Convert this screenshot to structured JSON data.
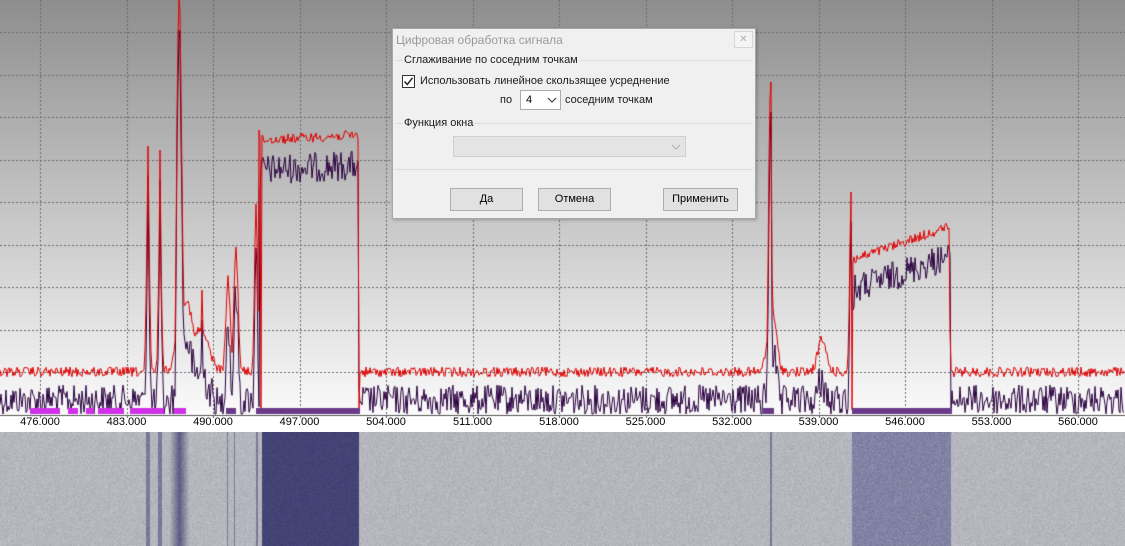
{
  "dialog": {
    "title": "Цифровая обработка сигнала",
    "close_icon": "close-icon",
    "smoothing_group_label": "Сглаживание по соседним точкам",
    "checkbox_label": "Использовать линейное скользящее усреднение",
    "checkbox_checked": true,
    "prefix_label": "по",
    "points_value": "4",
    "suffix_label": "соседним точкам",
    "window_group_label": "Функция окна",
    "window_value": "",
    "ok_label": "Да",
    "cancel_label": "Отмена",
    "apply_label": "Применить"
  },
  "spectrum": {
    "x_tick_labels": [
      "476.000",
      "483.000",
      "490.000",
      "497.000",
      "504.000",
      "511.000",
      "518.000",
      "525.000",
      "532.000",
      "539.000",
      "546.000",
      "553.000",
      "560.000"
    ],
    "colors": {
      "peak_trace": "#e00000",
      "avg_trace": "#2a0040",
      "band_marker": "#d030e8",
      "band_marker_dark": "#6a3a8a",
      "waterfall_signal": "#3e3d70"
    }
  }
}
